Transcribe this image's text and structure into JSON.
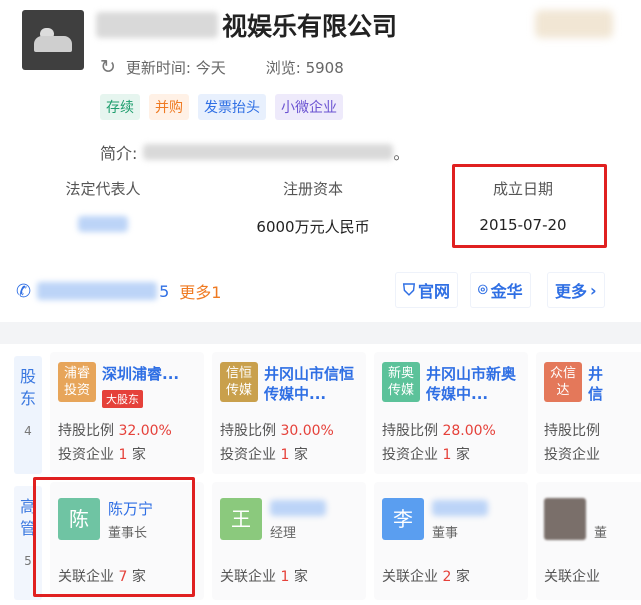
{
  "company": {
    "name_tail": "视娱乐有限公司",
    "refresh_icon": "refresh-icon",
    "update_time": "更新时间: 今天",
    "views": "浏览: 5908",
    "tags": [
      "存续",
      "并购",
      "发票抬头",
      "小微企业"
    ],
    "intro_label": "简介:",
    "intro_end": "。"
  },
  "info": {
    "legal_rep_label": "法定代表人",
    "capital_label": "注册资本",
    "capital_value": "6000万元人民币",
    "founded_label": "成立日期",
    "founded_value": "2015-07-20"
  },
  "contact": {
    "phone_tail": "5",
    "more_phones": "更多1",
    "website": "官网",
    "location": "金华",
    "more": "更多"
  },
  "shareholders": {
    "label": "股东",
    "count": "4",
    "items": [
      {
        "logo": "浦睿投资",
        "name": "深圳浦睿...",
        "badge": "大股东",
        "ratio_label": "持股比例 ",
        "ratio": "32.00%",
        "invest_label": "投资企业 ",
        "invest_count": "1",
        "unit": " 家"
      },
      {
        "logo": "信恒传媒",
        "name": "井冈山市信恒传媒中...",
        "badge": "",
        "ratio_label": "持股比例 ",
        "ratio": "30.00%",
        "invest_label": "投资企业 ",
        "invest_count": "1",
        "unit": " 家"
      },
      {
        "logo": "新奥传媒",
        "name": "井冈山市新奥传媒中...",
        "badge": "",
        "ratio_label": "持股比例 ",
        "ratio": "28.00%",
        "invest_label": "投资企业 ",
        "invest_count": "1",
        "unit": " 家"
      },
      {
        "logo": "众信达",
        "name": "井信",
        "badge": "",
        "ratio_label": "持股比例",
        "ratio": "",
        "invest_label": "投资企业",
        "invest_count": "",
        "unit": ""
      }
    ]
  },
  "executives": {
    "label": "高管",
    "count": "5",
    "items": [
      {
        "avatar": "陈",
        "name": "陈万宁",
        "role": "董事长",
        "assoc_label": "关联企业 ",
        "assoc_count": "7",
        "unit": " 家"
      },
      {
        "avatar": "王",
        "name": "",
        "role": "经理",
        "assoc_label": "关联企业 ",
        "assoc_count": "1",
        "unit": " 家"
      },
      {
        "avatar": "李",
        "name": "",
        "role": "董事",
        "assoc_label": "关联企业 ",
        "assoc_count": "2",
        "unit": " 家"
      },
      {
        "avatar": "",
        "name": "",
        "role": "董",
        "assoc_label": "关联企业",
        "assoc_count": "",
        "unit": ""
      }
    ]
  },
  "colors": {
    "accent": "#2f6fe4",
    "highlight": "#e02020",
    "orange": "#ef7a22",
    "red": "#e5413a"
  }
}
